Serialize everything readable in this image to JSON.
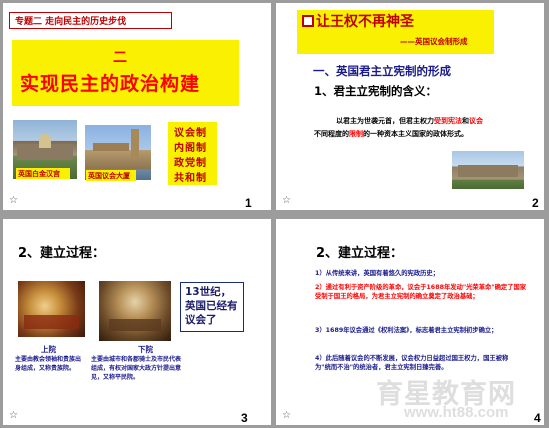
{
  "slide1": {
    "topic": "专题二 走向民主的历史步伐",
    "unit_no": "二",
    "title": "实现民主的政治构建",
    "list": [
      "议会制",
      "内阁制",
      "政党制",
      "共和制"
    ],
    "caption_left": "英国白金汉宫",
    "caption_right": "英国议会大厦",
    "page": "1"
  },
  "slide2": {
    "title": "让王权不再神圣",
    "subtitle": "——英国议会制形成",
    "section": "一、英国君主立宪制的形成",
    "sub": "1、君主立宪制的含义：",
    "body_a": "以君主为世袭元首，但君主权力",
    "body_b": "受到宪法",
    "body_c": "和",
    "body_d": "议会",
    "body_e": "不同程度的",
    "body_f": "限制",
    "body_g": "的一种资本主义国家的政体形式。",
    "page": "2"
  },
  "slide3": {
    "heading": "2、建立过程：",
    "callout": "13世纪，英国已经有议会了",
    "label_left": "上院",
    "desc_left": "主要由教会领袖和贵族出身组成，又称贵族院。",
    "label_right": "下院",
    "desc_right": "主要由城市和各郡骑士及市民代表组成，有权对国家大政方针提出意见，又称平民院。",
    "page": "3"
  },
  "slide4": {
    "heading": "2、建立过程：",
    "p1": "1）从传统来讲，英国有着悠久的宪政历史；",
    "p2": "2）通过有利于资产阶级的革命，议会于1688年发动\"光荣革命\"确定了国家受制于国王的格局，为君主立宪制的确立奠定了政治基础；",
    "p3": "3）1689年议会通过《权利法案》，标志着君主立宪制初步确立；",
    "p4": "4）此后随着议会的不断发展，议会权力日益超过国王权力，国王被称为\"统而不治\"的统治者，君主立宪制日臻完善。",
    "page": "4"
  },
  "watermark": {
    "logo": "育星教育网",
    "url": "www.ht88.com"
  }
}
